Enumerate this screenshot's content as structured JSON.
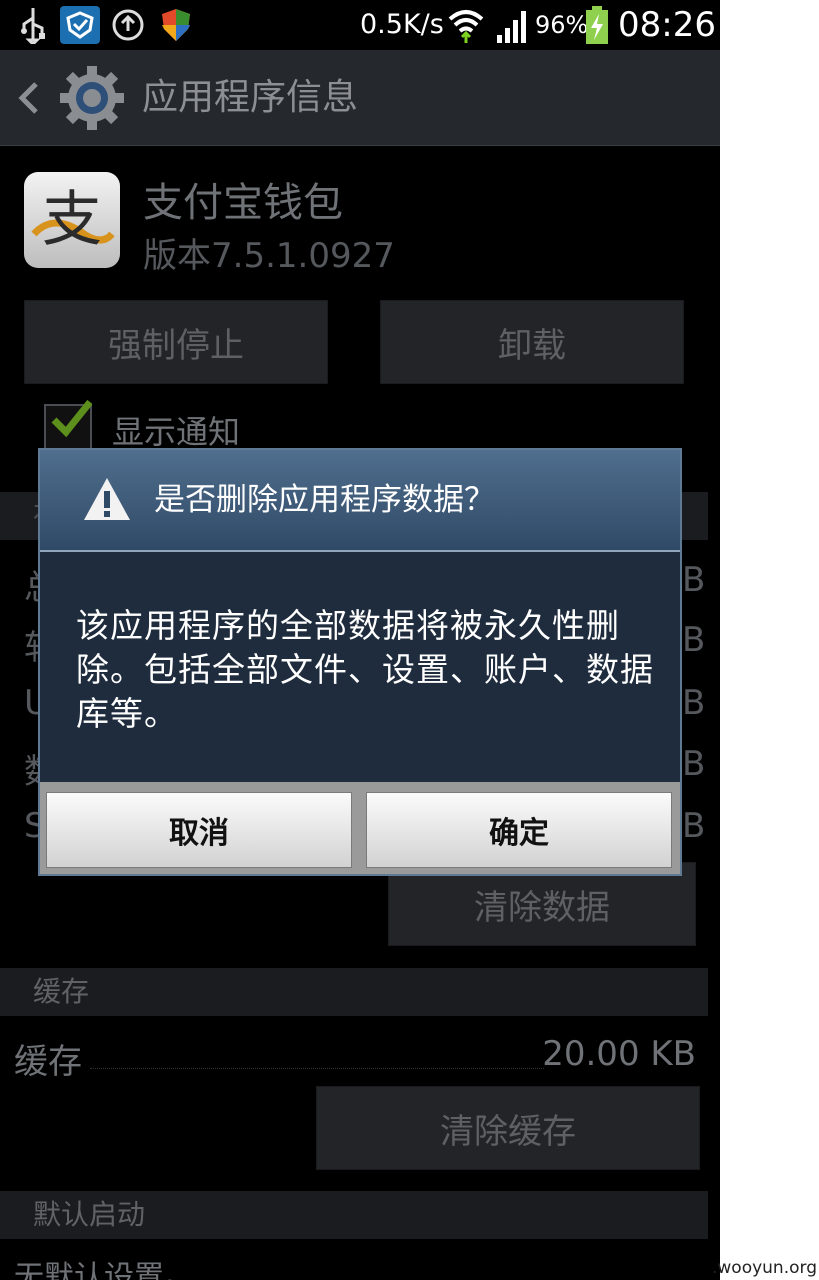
{
  "status_bar": {
    "net_speed": "0.5K/s",
    "battery_percent": "96%",
    "time": "08:26",
    "icons": [
      "usb-icon",
      "shield-app-icon",
      "sync-icon",
      "security-shield-icon",
      "wifi-icon",
      "signal-icon",
      "battery-charging-icon"
    ]
  },
  "action_bar": {
    "title": "应用程序信息",
    "icons": [
      "back-icon",
      "settings-gear-icon"
    ]
  },
  "app": {
    "name": "支付宝钱包",
    "version": "版本7.5.1.0927",
    "icon": "alipay-icon",
    "icon_glyph": "支"
  },
  "buttons": {
    "force_stop": "强制停止",
    "uninstall": "卸载",
    "clear_data": "清除数据",
    "clear_cache": "清除缓存"
  },
  "show_notifications": {
    "label": "显示通知",
    "checked": true
  },
  "storage_partial": {
    "header_edge": "存",
    "rows": [
      {
        "label_edge": "总",
        "value_edge": "B"
      },
      {
        "label_edge": "软",
        "value_edge": "B"
      },
      {
        "label_edge": "U",
        "value_edge": "B"
      },
      {
        "label_edge": "数",
        "value_edge": "B"
      },
      {
        "label_edge": "S",
        "value_edge": "B"
      }
    ]
  },
  "cache_section": {
    "header": "缓存",
    "row_label": "缓存",
    "row_value": "20.00 KB"
  },
  "default_launch": {
    "header": "默认启动",
    "value": "无默认设置。"
  },
  "dialog": {
    "title": "是否删除应用程序数据？",
    "message": "该应用程序的全部数据将被永久性删除。包括全部文件、设置、账户、数据库等。",
    "cancel": "取消",
    "confirm": "确定"
  },
  "watermark": ".wooyun.org"
}
